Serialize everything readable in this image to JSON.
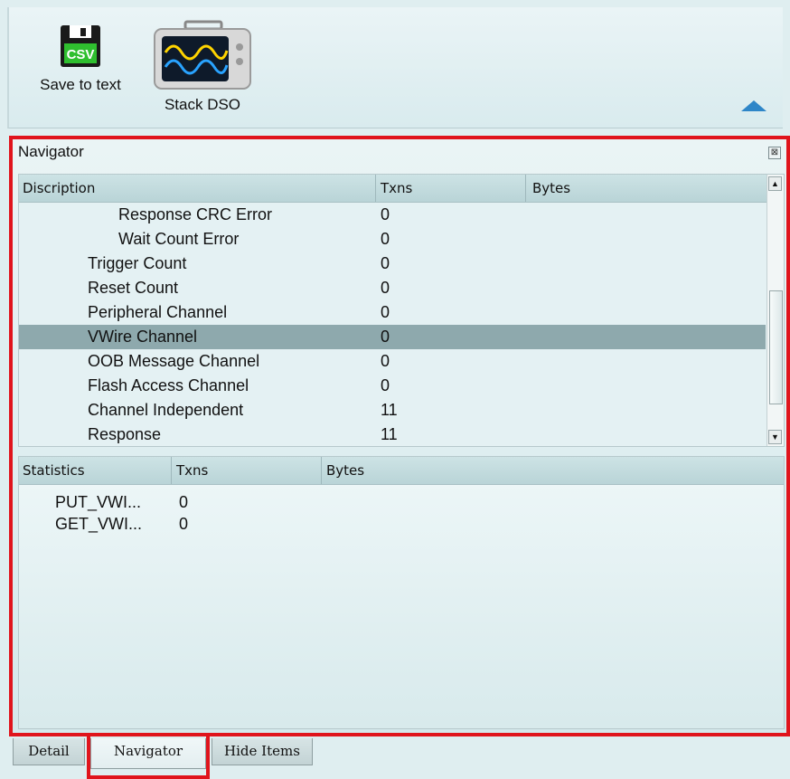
{
  "toolbar": {
    "save_label": "Save to text",
    "save_icon_text": "CSV",
    "stack_label": "Stack DSO"
  },
  "navigator": {
    "title": "Navigator",
    "close_glyph": "⊠",
    "columns": [
      "Discription",
      "Txns",
      "Bytes"
    ],
    "rows": [
      {
        "label": "Response CRC Error",
        "txns": "0",
        "indent": 2
      },
      {
        "label": "Wait Count Error",
        "txns": "0",
        "indent": 2
      },
      {
        "label": "Trigger Count",
        "txns": "0",
        "indent": 1
      },
      {
        "label": "Reset Count",
        "txns": "0",
        "indent": 1
      },
      {
        "label": "Peripheral Channel",
        "txns": "0",
        "indent": 1
      },
      {
        "label": "VWire Channel",
        "txns": "0",
        "indent": 1,
        "selected": true
      },
      {
        "label": "OOB Message Channel",
        "txns": "0",
        "indent": 1
      },
      {
        "label": "Flash Access Channel",
        "txns": "0",
        "indent": 1
      },
      {
        "label": "Channel Independent",
        "txns": "11",
        "indent": 1
      },
      {
        "label": "Response",
        "txns": "11",
        "indent": 1
      }
    ]
  },
  "statistics": {
    "columns": [
      "Statistics",
      "Txns",
      "Bytes"
    ],
    "rows": [
      {
        "label": "PUT_VWI...",
        "txns": "0"
      },
      {
        "label": "GET_VWI...",
        "txns": "0"
      }
    ]
  },
  "tabs": [
    {
      "label": "Detail",
      "active": false
    },
    {
      "label": "Navigator",
      "active": true
    },
    {
      "label": "Hide Items",
      "active": false
    }
  ],
  "colors": {
    "highlight": "#e0141c",
    "selected_row": "#8ea9ad",
    "accent_arrow": "#2e86c8"
  }
}
